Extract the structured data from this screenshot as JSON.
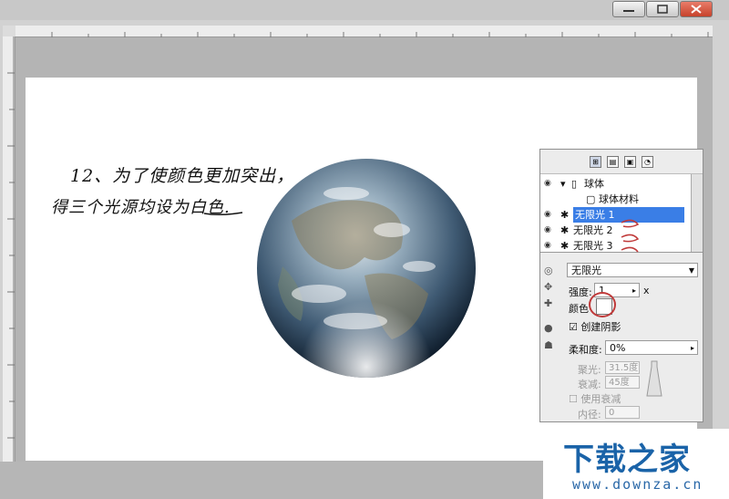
{
  "window": {
    "minimize_icon": "minimize-icon",
    "maximize_icon": "maximize-icon",
    "close_icon": "close-icon"
  },
  "annotation": {
    "line1": "12、为了使颜色更加突出，",
    "line2": "得三个光源均设为白色."
  },
  "panel": {
    "tabs": [
      "object-tab",
      "material-tab",
      "lighting-tab",
      "light-tab"
    ],
    "tree": [
      {
        "label": "球体",
        "icon": "sphere-icon"
      },
      {
        "label": "球体材料",
        "icon": "material-icon"
      },
      {
        "label": "无限光 1",
        "icon": "light-icon"
      },
      {
        "label": "无限光 2",
        "icon": "light-icon"
      },
      {
        "label": "无限光 3",
        "icon": "light-icon"
      }
    ],
    "light_type": "无限光",
    "intensity_label": "强度:",
    "intensity_value": "1",
    "intensity_suffix": "x",
    "color_label": "颜色",
    "shadow_label": "创建阴影",
    "softness_label": "柔和度:",
    "softness_value": "0%",
    "cone_label": "聚光:",
    "cone_value": "31.5度",
    "hotspot_label": "衰减:",
    "hotspot_value": "45度",
    "attenuation_label": "使用衰减",
    "inner_label": "内径:",
    "inner_value": "0"
  },
  "watermark": {
    "brand": "下载之家",
    "url": "www.downza.cn"
  },
  "colors": {
    "accent": "#3a7ee6",
    "brand": "#1a63a8",
    "annotation": "#c03a3a"
  }
}
